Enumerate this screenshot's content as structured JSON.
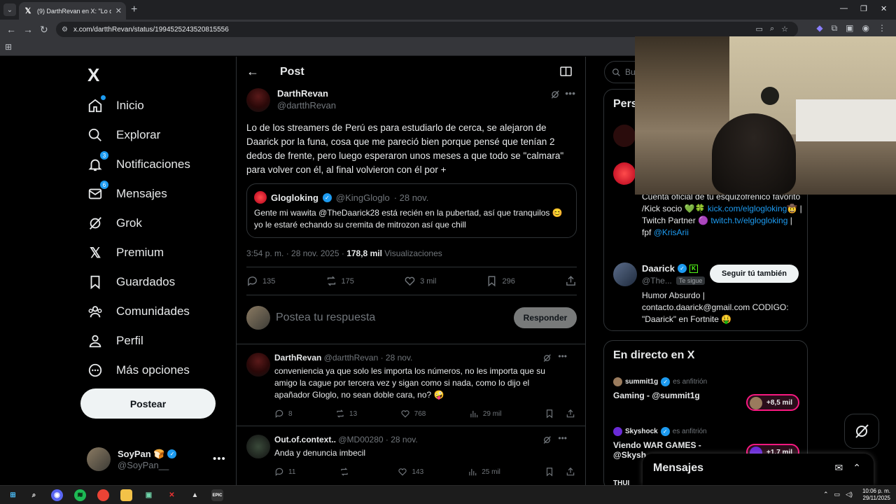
{
  "browser": {
    "tab_title": "(9) DarthRevan en X: \"Lo de los",
    "url": "x.com/dartthRevan/status/1994525243520815556",
    "new_tab": "+",
    "tab_close": "✕"
  },
  "sidebar": {
    "logo": "X",
    "items": [
      {
        "label": "Inicio"
      },
      {
        "label": "Explorar"
      },
      {
        "label": "Notificaciones",
        "badge": "3"
      },
      {
        "label": "Mensajes",
        "badge": "6"
      },
      {
        "label": "Grok"
      },
      {
        "label": "Premium"
      },
      {
        "label": "Guardados"
      },
      {
        "label": "Comunidades"
      },
      {
        "label": "Perfil"
      },
      {
        "label": "Más opciones"
      }
    ],
    "post_button": "Postear",
    "account": {
      "name": "SoyPan 🍞",
      "handle": "@SoyPan__"
    }
  },
  "main": {
    "header_title": "Post",
    "post": {
      "author_name": "DarthRevan",
      "author_handle": "@dartthRevan",
      "text": "Lo de los streamers de Perú es para estudiarlo de cerca, se alejaron de Daarick por la funa, cosa que me pareció bien porque pensé que tenían 2 dedos de frente, pero luego esperaron unos meses a que todo se \"calmara\" para volver con él, al final volvieron con él por +",
      "quote": {
        "name": "Glogloking",
        "handle": "@KingGloglo",
        "time": "· 28 nov.",
        "text": "Gente mi wawita @TheDaarick28  está recién en la pubertad, así que tranquilos 😊 yo le estaré echando su cremita de mitrozon así que chill"
      },
      "timestamp": "3:54 p. m. · 28 nov. 2025 ·",
      "views": "178,8 mil",
      "views_label": "Visualizaciones",
      "stats": {
        "replies": "135",
        "reposts": "175",
        "likes": "3 mil",
        "bookmarks": "296"
      }
    },
    "reply_box": {
      "placeholder": "Postea tu respuesta",
      "button": "Responder"
    },
    "replies": [
      {
        "name": "DarthRevan",
        "handle": "@dartthRevan · 28 nov.",
        "text": "conveniencia ya que solo les importa los números, no les importa que su amigo la cague por tercera vez  y sigan como si nada, como lo dijo el apañador Gloglo, no sean doble cara, no? 🤪",
        "replies": "8",
        "reposts": "13",
        "likes": "768",
        "views": "29 mil"
      },
      {
        "name": "Out.of.context..",
        "handle": "@MD00280 · 28 nov.",
        "text": "Anda y denuncia imbecil",
        "replies": "11",
        "reposts": "",
        "likes": "143",
        "views": "25 mil"
      }
    ]
  },
  "right": {
    "search_placeholder": "Bus",
    "who_to_follow_title": "Pers",
    "bio1": "Cuenta oficial de tu esquizofrénico favorito /Kick socio 💚🍀",
    "bio1_link1": "kick.com/elglogloking",
    "bio1_mid": "🤠 | Twitch Partner 🟣",
    "bio1_link2": "twitch.tv/elglogloking",
    "bio1_tail": "| fpf",
    "bio1_link3": "@KrisArii",
    "daarick": {
      "name": "Daarick",
      "handle": "@The...",
      "follows_you": "Te sigue",
      "button": "Seguir tú también",
      "bio": "Humor Absurdo | contacto.daarick@gmail.com CODIGO: \"Daarick\" en Fortnite 🤑"
    },
    "live_title": "En directo en X",
    "live": [
      {
        "host": "summit1g",
        "role": "es anfitrión",
        "title": "Gaming - @summit1g",
        "count": "+8,5 mil"
      },
      {
        "host": "Skyshock",
        "role": "es anfitrión",
        "title": "Viendo WAR GAMES - @Skysh",
        "count": "+1,7 mil"
      }
    ],
    "live_more": "THUI"
  },
  "messages_drawer": {
    "title": "Mensajes"
  },
  "taskbar": {
    "time": "10:06 p. m.",
    "date": "29/11/2025"
  }
}
